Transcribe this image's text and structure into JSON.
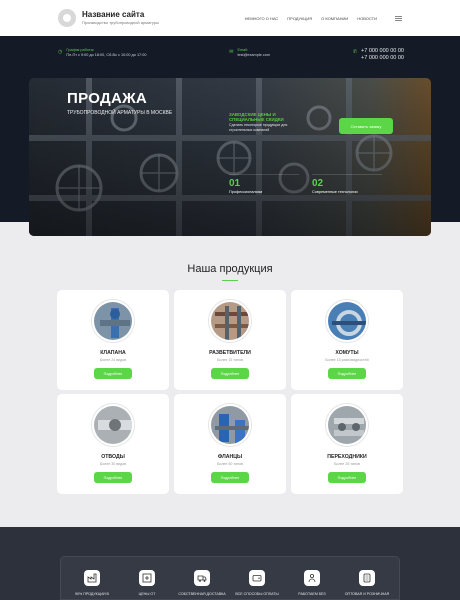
{
  "header": {
    "site_title": "Название сайта",
    "site_subtitle": "Производство трубопроводной арматуры",
    "nav": [
      "Немного о нас",
      "Продукция",
      "О компании",
      "Новости"
    ],
    "menu_icon": "hamburger-icon"
  },
  "contacts": {
    "hours_label": "График работы:",
    "hours": "Пн-Пт с 9:00 до 18:00, Сб-Вс с 10:00 до 17:00",
    "email_label": "Email:",
    "email": "test@example.com",
    "phone1": "+7 000 000 00 00",
    "phone2": "+7 000 000 00 00"
  },
  "hero": {
    "title": "ПРОДАЖА",
    "subtitle": "трубопроводной арматуры в Москве",
    "promo_head": "Заводские цены и специальные скидки",
    "promo_text": "Сделать некоторые продукции для строительных компаний",
    "button": "Оставить заявку",
    "features": [
      {
        "num": "01",
        "label": "Профессионализм"
      },
      {
        "num": "02",
        "label": "Современные технологии"
      }
    ]
  },
  "products": {
    "title": "Наша продукция",
    "items": [
      {
        "name": "Клапана",
        "price": "Более 24 видов",
        "button": "Подробнее"
      },
      {
        "name": "Разветвители",
        "price": "Более 15 типов",
        "button": "Подробнее"
      },
      {
        "name": "Хомуты",
        "price": "Более 15 разновидностей",
        "button": "Подробнее"
      },
      {
        "name": "Отводы",
        "price": "Более 30 видов",
        "button": "Подробнее"
      },
      {
        "name": "Фланцы",
        "price": "Более 50 типов",
        "button": "Подробнее"
      },
      {
        "name": "Переходники",
        "price": "Более 25 типов",
        "button": "Подробнее"
      }
    ]
  },
  "advantages": [
    {
      "label": "90% продукции в",
      "icon": "factory-icon"
    },
    {
      "label": "Цены от",
      "icon": "price-tag-icon"
    },
    {
      "label": "Собственная доставка",
      "icon": "truck-icon"
    },
    {
      "label": "Все способы оплаты",
      "icon": "wallet-icon"
    },
    {
      "label": "Работаем без",
      "icon": "handshake-icon"
    },
    {
      "label": "Оптовая и розничная",
      "icon": "box-icon"
    }
  ],
  "colors": {
    "accent": "#5ad646",
    "dark": "#141a26",
    "footer": "#2c313b"
  }
}
